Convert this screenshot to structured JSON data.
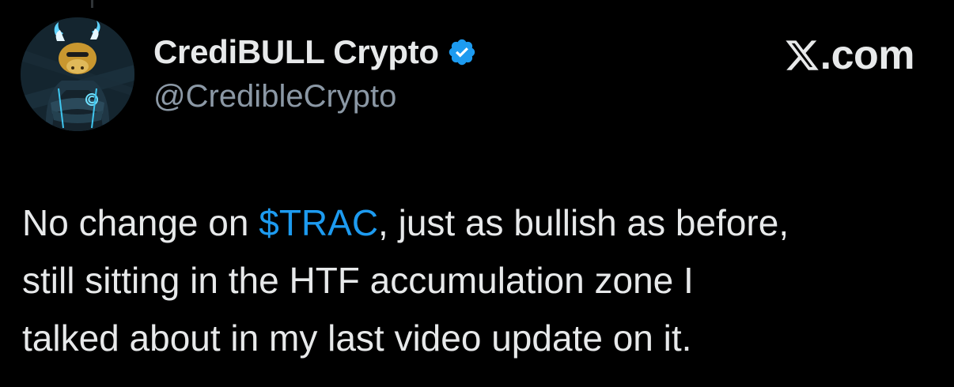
{
  "author": {
    "display_name": "CrediBULL Crypto",
    "handle": "@CredibleCrypto",
    "verified": true,
    "avatar_icon": "bull-mascot-avatar"
  },
  "brand": {
    "label": ".com",
    "logo_icon": "x-logo-icon"
  },
  "tweet": {
    "line1_pre": "No change on ",
    "cashtag": "$TRAC",
    "line1_post": ", just as bullish as before,",
    "line2": "still sitting in the HTF accumulation zone I",
    "line3": "talked about in my last video update on it."
  },
  "colors": {
    "background": "#000000",
    "primary_text": "#e7e9ea",
    "secondary_text": "#8b98a5",
    "link": "#1d9bf0",
    "verified_badge": "#1d9bf0"
  }
}
